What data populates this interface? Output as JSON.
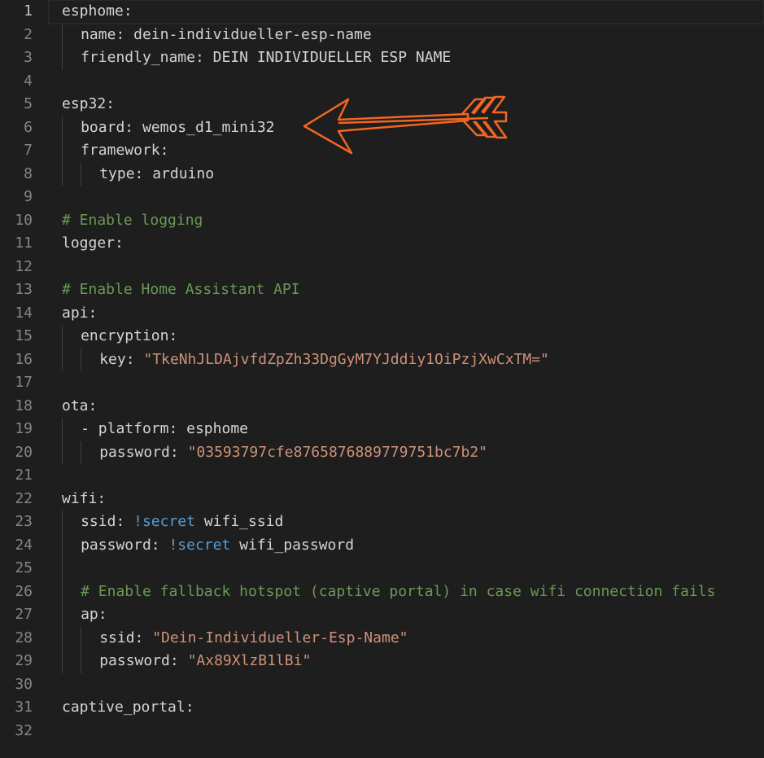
{
  "editor": {
    "lines": [
      {
        "n": "1",
        "indent": 0,
        "tokens": [
          {
            "t": "esphome:",
            "c": "k"
          }
        ]
      },
      {
        "n": "2",
        "indent": 1,
        "tokens": [
          {
            "t": "name: dein-individueller-esp-name",
            "c": "k"
          }
        ]
      },
      {
        "n": "3",
        "indent": 1,
        "tokens": [
          {
            "t": "friendly_name: DEIN INDIVIDUELLER ESP NAME",
            "c": "k"
          }
        ]
      },
      {
        "n": "4",
        "indent": 0,
        "tokens": []
      },
      {
        "n": "5",
        "indent": 0,
        "tokens": [
          {
            "t": "esp32:",
            "c": "k"
          }
        ]
      },
      {
        "n": "6",
        "indent": 1,
        "tokens": [
          {
            "t": "board: wemos_d1_mini32",
            "c": "k"
          }
        ]
      },
      {
        "n": "7",
        "indent": 1,
        "tokens": [
          {
            "t": "framework:",
            "c": "k"
          }
        ]
      },
      {
        "n": "8",
        "indent": 2,
        "tokens": [
          {
            "t": "type: arduino",
            "c": "k"
          }
        ]
      },
      {
        "n": "9",
        "indent": 0,
        "tokens": []
      },
      {
        "n": "10",
        "indent": 0,
        "tokens": [
          {
            "t": "# Enable logging",
            "c": "c"
          }
        ]
      },
      {
        "n": "11",
        "indent": 0,
        "tokens": [
          {
            "t": "logger:",
            "c": "k"
          }
        ]
      },
      {
        "n": "12",
        "indent": 0,
        "tokens": []
      },
      {
        "n": "13",
        "indent": 0,
        "tokens": [
          {
            "t": "# Enable Home Assistant API",
            "c": "c"
          }
        ]
      },
      {
        "n": "14",
        "indent": 0,
        "tokens": [
          {
            "t": "api:",
            "c": "k"
          }
        ]
      },
      {
        "n": "15",
        "indent": 1,
        "tokens": [
          {
            "t": "encryption:",
            "c": "k"
          }
        ]
      },
      {
        "n": "16",
        "indent": 2,
        "tokens": [
          {
            "t": "key: ",
            "c": "k"
          },
          {
            "t": "\"TkeNhJLDAjvfdZpZh33DgGyM7YJddiy1OiPzjXwCxTM=\"",
            "c": "s"
          }
        ]
      },
      {
        "n": "17",
        "indent": 0,
        "tokens": []
      },
      {
        "n": "18",
        "indent": 0,
        "tokens": [
          {
            "t": "ota:",
            "c": "k"
          }
        ]
      },
      {
        "n": "19",
        "indent": 1,
        "tokens": [
          {
            "t": "- platform: esphome",
            "c": "k"
          }
        ]
      },
      {
        "n": "20",
        "indent": 2,
        "tokens": [
          {
            "t": "password: ",
            "c": "k"
          },
          {
            "t": "\"03593797cfe8765876889779751bc7b2\"",
            "c": "s"
          }
        ]
      },
      {
        "n": "21",
        "indent": 0,
        "tokens": []
      },
      {
        "n": "22",
        "indent": 0,
        "tokens": [
          {
            "t": "wifi:",
            "c": "k"
          }
        ]
      },
      {
        "n": "23",
        "indent": 1,
        "tokens": [
          {
            "t": "ssid: ",
            "c": "k"
          },
          {
            "t": "!secret",
            "c": "t"
          },
          {
            "t": " wifi_ssid",
            "c": "k"
          }
        ]
      },
      {
        "n": "24",
        "indent": 1,
        "tokens": [
          {
            "t": "password: ",
            "c": "k"
          },
          {
            "t": "!secret",
            "c": "t"
          },
          {
            "t": " wifi_password",
            "c": "k"
          }
        ]
      },
      {
        "n": "25",
        "indent": 1,
        "tokens": []
      },
      {
        "n": "26",
        "indent": 1,
        "tokens": [
          {
            "t": "# Enable fallback hotspot (captive portal) in case wifi connection fails",
            "c": "c"
          }
        ]
      },
      {
        "n": "27",
        "indent": 1,
        "tokens": [
          {
            "t": "ap:",
            "c": "k"
          }
        ]
      },
      {
        "n": "28",
        "indent": 2,
        "tokens": [
          {
            "t": "ssid: ",
            "c": "k"
          },
          {
            "t": "\"Dein-Individueller-Esp-Name\"",
            "c": "s"
          }
        ]
      },
      {
        "n": "29",
        "indent": 2,
        "tokens": [
          {
            "t": "password: ",
            "c": "k"
          },
          {
            "t": "\"Ax89XlzB1lBi\"",
            "c": "s"
          }
        ]
      },
      {
        "n": "30",
        "indent": 0,
        "tokens": []
      },
      {
        "n": "31",
        "indent": 0,
        "tokens": [
          {
            "t": "captive_portal:",
            "c": "k"
          }
        ]
      },
      {
        "n": "32",
        "indent": 0,
        "tokens": []
      }
    ],
    "current_line": 1
  },
  "annotation": {
    "icon": "arrow-icon",
    "color": "#f26522"
  },
  "colors": {
    "background": "#1e1e1e",
    "key": "#d4d4d4",
    "string": "#ce9178",
    "comment": "#6a9955",
    "tag": "#569cd6"
  }
}
